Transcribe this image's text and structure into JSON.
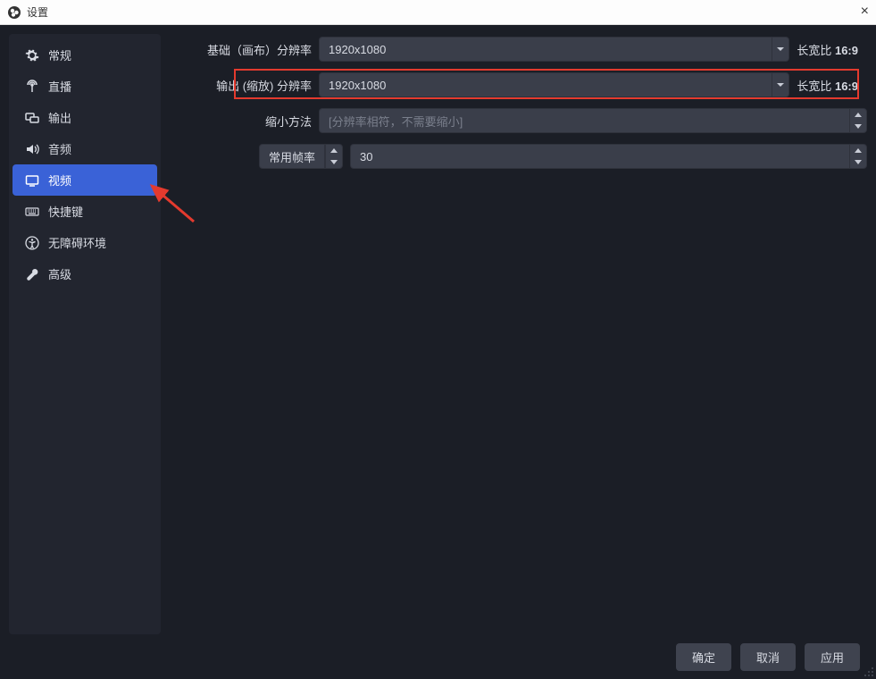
{
  "titlebar": {
    "title": "设置"
  },
  "sidebar": {
    "items": [
      {
        "label": "常规"
      },
      {
        "label": "直播"
      },
      {
        "label": "输出"
      },
      {
        "label": "音频"
      },
      {
        "label": "视频"
      },
      {
        "label": "快捷键"
      },
      {
        "label": "无障碍环境"
      },
      {
        "label": "高级"
      }
    ]
  },
  "video": {
    "base_label": "基础（画布）分辨率",
    "base_value": "1920x1080",
    "base_aspect_prefix": "长宽比 ",
    "base_aspect_value": "16:9",
    "output_label": "输出 (缩放) 分辨率",
    "output_value": "1920x1080",
    "output_aspect_prefix": "长宽比 ",
    "output_aspect_value": "16:9",
    "downscale_label": "缩小方法",
    "downscale_placeholder": "[分辨率相符，不需要缩小]",
    "fps_type_label": "常用帧率",
    "fps_value": "30"
  },
  "footer": {
    "ok": "确定",
    "cancel": "取消",
    "apply": "应用"
  }
}
